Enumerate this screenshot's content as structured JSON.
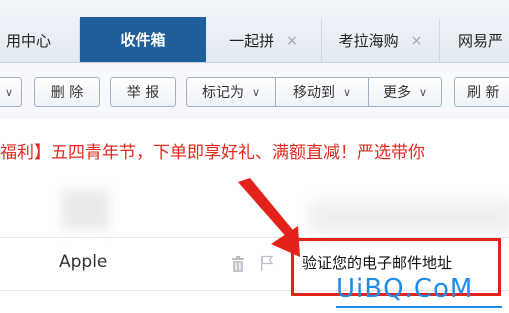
{
  "tabs": {
    "app": "用中心",
    "inbox": "收件箱",
    "yiqipin": "一起拼",
    "kaola": "考拉海购",
    "wangyi": "网易严",
    "close": "×"
  },
  "toolbar": {
    "delete": "删 除",
    "report": "举 报",
    "mark": "标记为",
    "move": "移动到",
    "more": "更多",
    "refresh": "刷 新"
  },
  "promo": "福利】五四青年节，下单即享好礼、满额直减！严选带你",
  "mail": {
    "sender": "Apple",
    "subject": "验证您的电子邮件地址"
  },
  "watermark": "UiBQ.CoM",
  "colors": {
    "tab_active": "#1e5f9c",
    "promo": "#e02a1e",
    "highlight": "#e3231b",
    "watermark": "#1f8de8"
  },
  "icons": [
    "chevron-down-icon",
    "close-icon",
    "trash-icon",
    "flag-icon",
    "arrow-annotation"
  ]
}
